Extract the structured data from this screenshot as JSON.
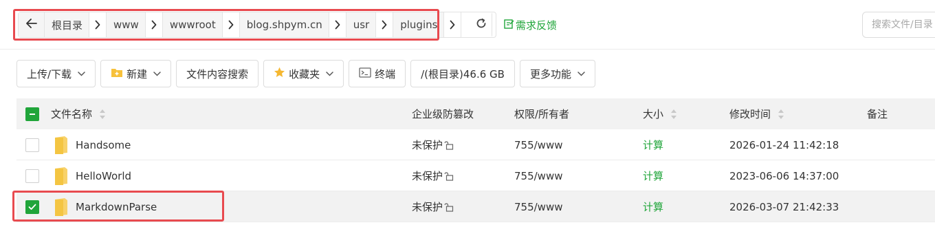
{
  "breadcrumb": {
    "segments": [
      "根目录",
      "www",
      "wwwroot",
      "blog.shpym.cn",
      "usr",
      "plugins"
    ]
  },
  "feedback_label": "需求反馈",
  "search": {
    "placeholder": "搜索文件/目录"
  },
  "toolbar": {
    "upload_label": "上传/下载",
    "new_label": "新建",
    "content_search_label": "文件内容搜索",
    "favorites_label": "收藏夹",
    "terminal_label": "终端",
    "disk_label": "/(根目录)46.6 GB",
    "more_label": "更多功能"
  },
  "table": {
    "headers": {
      "name": "文件名称",
      "protection": "企业级防篡改",
      "permission": "权限/所有者",
      "size": "大小",
      "modified": "修改时间",
      "note": "备注"
    },
    "rows": [
      {
        "name": "Handsome",
        "protection": "未保护",
        "permission": "755/www",
        "size": "计算",
        "modified": "2026-01-24 11:42:18",
        "checked": false
      },
      {
        "name": "HelloWorld",
        "protection": "未保护",
        "permission": "755/www",
        "size": "计算",
        "modified": "2023-06-06 14:37:00",
        "checked": false
      },
      {
        "name": "MarkdownParse",
        "protection": "未保护",
        "permission": "755/www",
        "size": "计算",
        "modified": "2026-03-07 21:42:33",
        "checked": true
      }
    ]
  },
  "colors": {
    "accent": "#20a53a",
    "highlight": "#e84a4f",
    "folder": "#f7c948"
  },
  "icons": [
    "back-arrow-icon",
    "chevron-right-icon",
    "refresh-icon",
    "feedback-icon",
    "chevron-down-icon",
    "new-folder-icon",
    "star-icon",
    "terminal-icon",
    "sort-icon",
    "folder-icon",
    "unlock-icon",
    "check-icon"
  ]
}
